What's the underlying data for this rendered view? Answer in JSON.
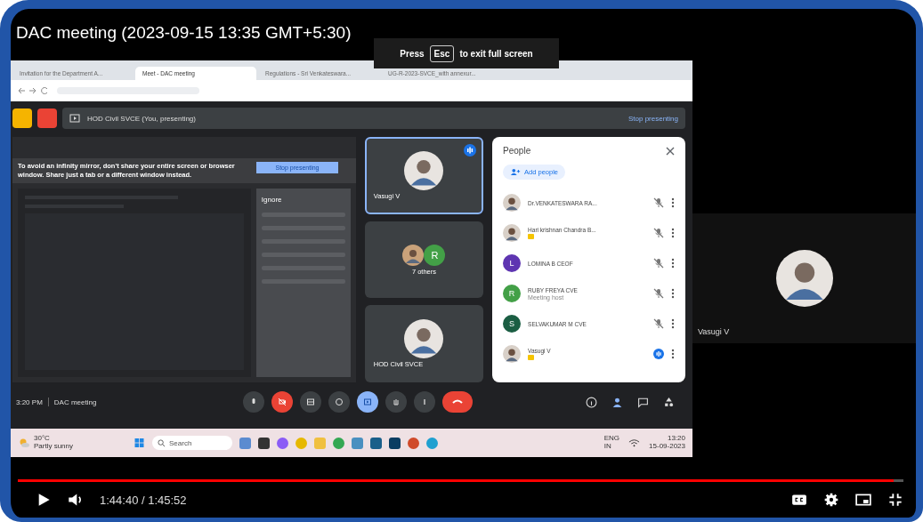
{
  "player_title": "DAC meeting (2023-09-15 13:35 GMT+5:30)",
  "esc_hint": {
    "before": "Press",
    "key": "Esc",
    "after": "to exit full screen"
  },
  "browser": {
    "tabs": [
      {
        "label": "Invitation for the Department A...",
        "selected": false
      },
      {
        "label": "Meet - DAC meeting",
        "selected": true
      },
      {
        "label": "Regulations - Sri Venkateswara...",
        "selected": false
      },
      {
        "label": "UG-R-2023-SVCE_with annexur...",
        "selected": false
      }
    ]
  },
  "meet": {
    "presenting_label": "HOD Civil SVCE (You, presenting)",
    "stop_link": "Stop presenting",
    "warning": "To avoid an infinity mirror, don't share your entire screen or browser window. Share just a tab or a different window instead.",
    "stop_button": "Stop presenting",
    "ignore": "Ignore",
    "tiles": [
      {
        "name": "Vasugi V",
        "selected": true,
        "kind": "photo"
      },
      {
        "name": "7 others",
        "selected": false,
        "kind": "group",
        "letter": "R",
        "color": "#43a047"
      },
      {
        "name": "HOD Civil SVCE",
        "selected": false,
        "kind": "photo"
      }
    ],
    "people": {
      "title": "People",
      "add": "Add people",
      "rows": [
        {
          "name": "Dr.VENKATESWARA RA...",
          "kind": "photo",
          "mic_off": true,
          "badge": false
        },
        {
          "name": "Hari krishnan Chandra B...",
          "kind": "photo",
          "mic_off": true,
          "badge": true
        },
        {
          "name": "LOMINA B CEOF",
          "kind": "letter",
          "letter": "L",
          "color": "#5e35b1",
          "mic_off": true,
          "badge": false
        },
        {
          "name": "RUBY FREYA CVE",
          "sub": "Meeting host",
          "kind": "letter",
          "letter": "R",
          "color": "#43a047",
          "mic_off": true,
          "badge": false
        },
        {
          "name": "SELVAKUMAR M CVE",
          "kind": "letter",
          "letter": "S",
          "color": "#1b5e43",
          "mic_off": true,
          "badge": false
        },
        {
          "name": "Vasugi V",
          "kind": "photo",
          "mic_off": false,
          "badge": true
        }
      ]
    },
    "time": "3:20 PM",
    "meeting": "DAC meeting",
    "camera_off": true
  },
  "taskbar": {
    "temp": "30°C",
    "weather": "Partly sunny",
    "search": "Search",
    "lang": "ENG",
    "region": "IN",
    "clock": "13:20",
    "date": "15-09-2023"
  },
  "side_tile": {
    "name": "Vasugi V"
  },
  "player": {
    "level": 0.989,
    "time": "1:44:40 / 1:45:52"
  }
}
